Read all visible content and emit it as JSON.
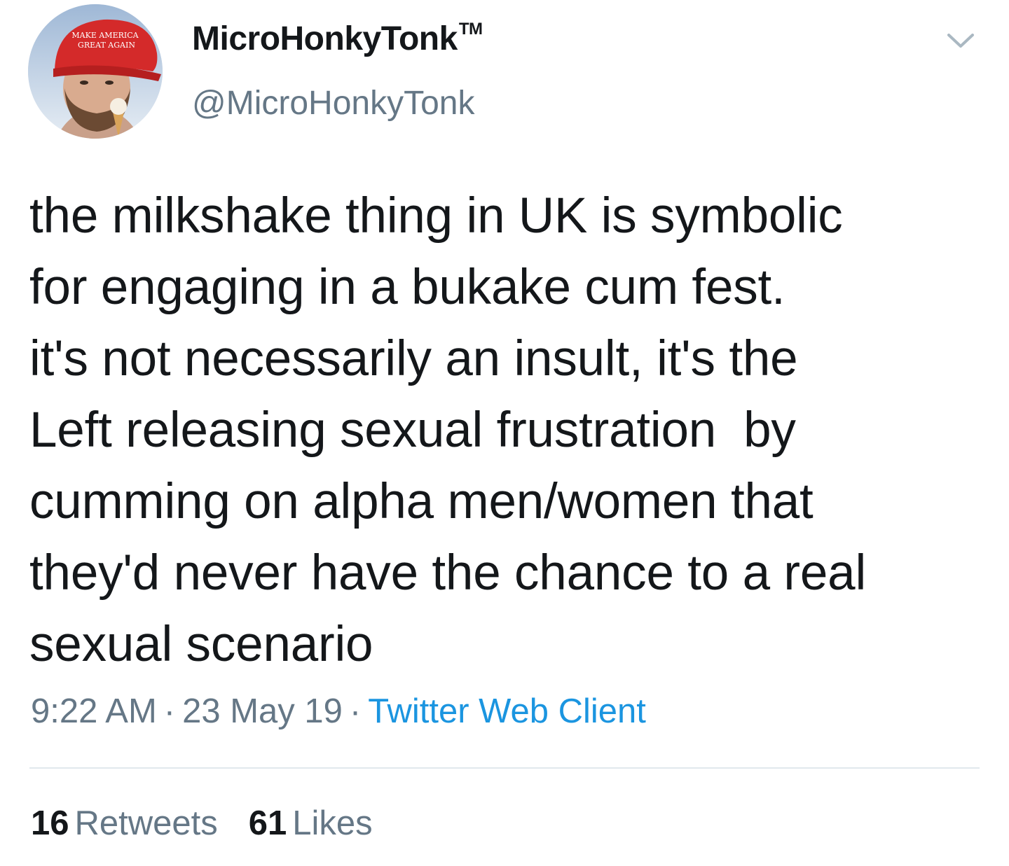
{
  "author": {
    "display_name": "MicroHonkyTonk",
    "trademark": "TM",
    "handle": "@MicroHonkyTonk",
    "hat_text_line1": "MAKE AMERICA",
    "hat_text_line2": "GREAT AGAIN"
  },
  "tweet": {
    "lines": [
      "the milkshake thing in UK is symbolic",
      "for engaging in a bukake cum fest.",
      "it's not necessarily an insult, it's the",
      "Left releasing sexual frustration  by",
      "cumming on alpha men/women that",
      "they'd never have the chance to a real",
      "sexual scenario"
    ]
  },
  "meta": {
    "time": "9:22 AM",
    "separator": "·",
    "date": "23 May 19",
    "source": "Twitter Web Client"
  },
  "stats": {
    "retweets_count": "16",
    "retweets_label": "Retweets",
    "likes_count": "61",
    "likes_label": "Likes"
  },
  "icons": {
    "menu": "chevron-down-icon"
  },
  "colors": {
    "text": "#14171a",
    "secondary": "#657786",
    "link": "#1b95e0",
    "divider": "#e1e8ed"
  }
}
